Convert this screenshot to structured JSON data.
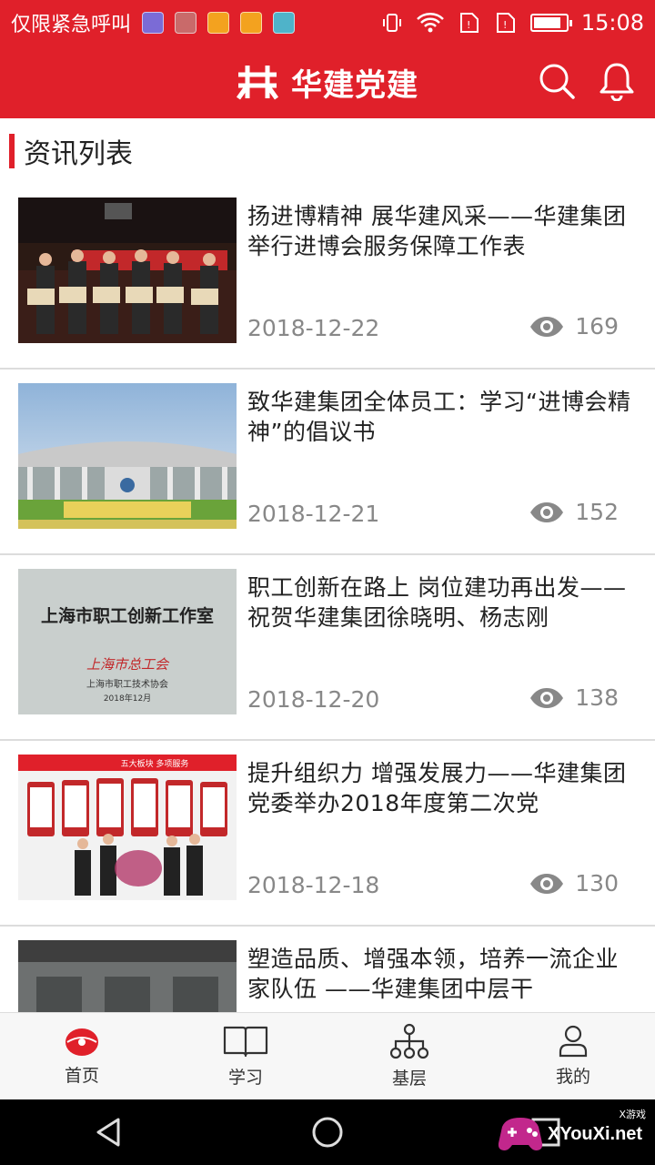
{
  "status_bar": {
    "carrier_text": "仅限紧急呼叫",
    "time": "15:08",
    "notification_icons": [
      "weibo-alt-icon",
      "gallery-icon",
      "weibo-icon",
      "weibo-icon",
      "app-icon"
    ],
    "battery_level": 0.85
  },
  "header": {
    "title": "华建党建"
  },
  "section": {
    "title": "资讯列表"
  },
  "news": [
    {
      "title": "扬进博精神 展华建风采——华建集团举行进博会服务保障工作表",
      "date": "2018-12-22",
      "views": "169"
    },
    {
      "title": "致华建集团全体员工：学习“进博会精神”的倡议书",
      "date": "2018-12-21",
      "views": "152"
    },
    {
      "title": "职工创新在路上 岗位建功再出发——祝贺华建集团徐晓明、杨志刚",
      "date": "2018-12-20",
      "views": "138",
      "thumb_text": {
        "heading": "上海市职工创新工作室",
        "script": "上海市总工会",
        "org": "上海市职工技术协会",
        "date": "2018年12月"
      }
    },
    {
      "title": "提升组织力 增强发展力——华建集团党委举办2018年度第二次党",
      "date": "2018-12-18",
      "views": "130",
      "thumb_text": {
        "heading": "五大板块 多项服务"
      }
    },
    {
      "title": "塑造品质、增强本领，培养一流企业家队伍 ——华建集团中层干",
      "date": "",
      "views": ""
    }
  ],
  "bottom_nav": [
    {
      "label": "首页",
      "icon": "home-icon",
      "active": true
    },
    {
      "label": "学习",
      "icon": "book-icon"
    },
    {
      "label": "基层",
      "icon": "org-tree-icon"
    },
    {
      "label": "我的",
      "icon": "user-icon"
    }
  ],
  "watermark": {
    "text": "XYouXi.net",
    "small": "X游戏"
  },
  "colors": {
    "brand_red": "#e0202a",
    "meta_gray": "#888888"
  }
}
